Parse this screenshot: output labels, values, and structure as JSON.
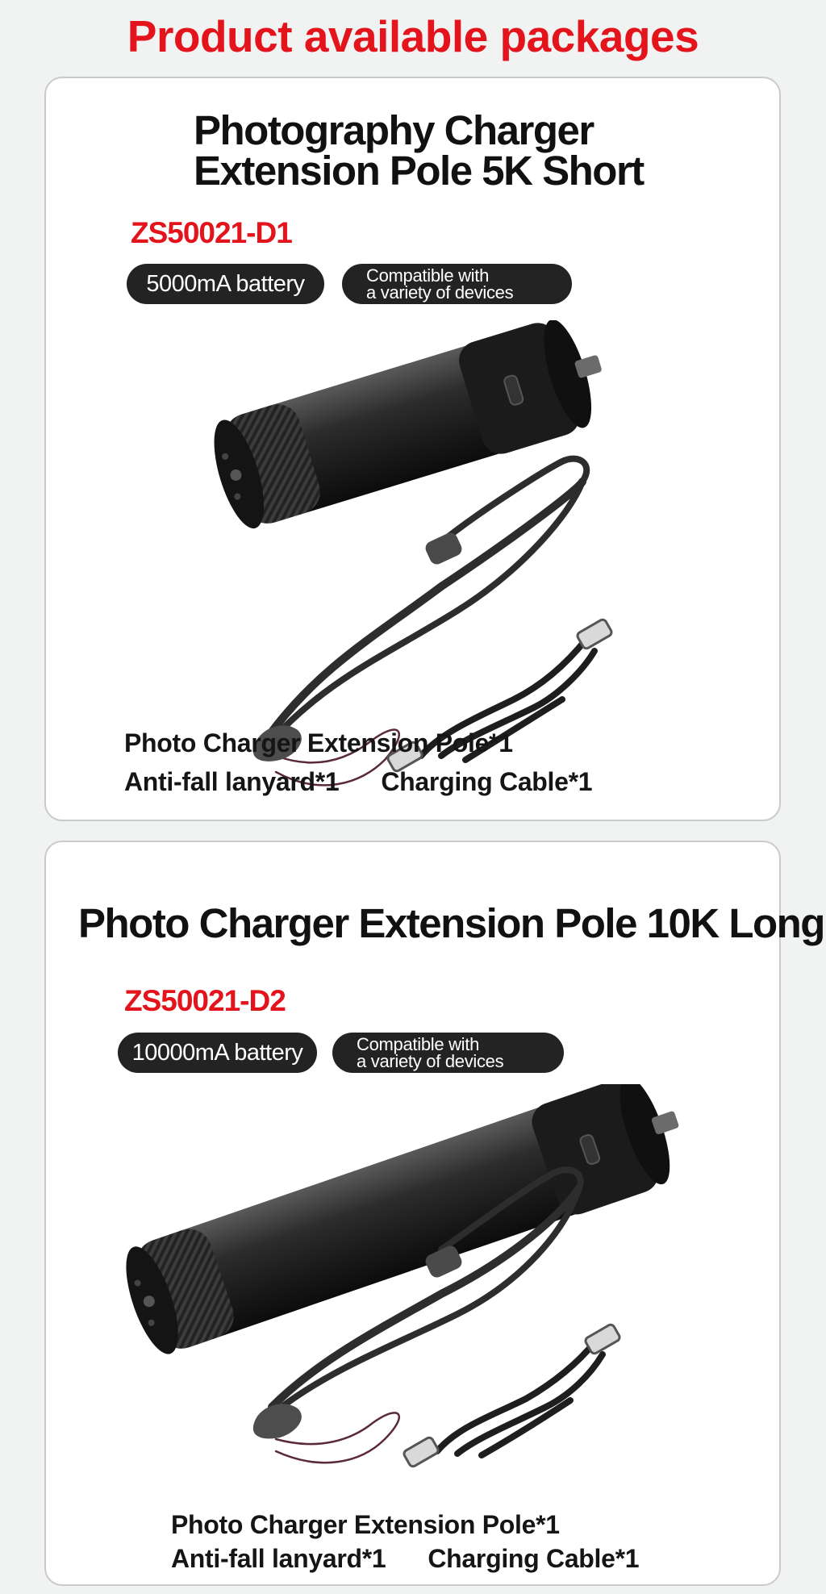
{
  "page": {
    "title": "Product available packages"
  },
  "packages": [
    {
      "title_line1": "Photography Charger",
      "title_line2": "Extension Pole 5K Short",
      "model": "ZS50021-D1",
      "battery": "5000mA battery",
      "compat_line1": "Compatible with",
      "compat_line2": "a  variety of devices",
      "contents": {
        "item1": "Photo Charger Extension Pole*1",
        "item2": "Anti-fall lanyard*1",
        "item3": "Charging Cable*1"
      }
    },
    {
      "title": "Photo Charger Extension Pole 10K Long",
      "model": "ZS50021-D2",
      "battery": "10000mA battery",
      "compat_line1": "Compatible with",
      "compat_line2": "a  variety of devices",
      "contents": {
        "item1": "Photo Charger Extension Pole*1",
        "item2": "Anti-fall lanyard*1",
        "item3": "Charging Cable*1"
      }
    }
  ],
  "colors": {
    "accent_red": "#e3141b",
    "pill_background": "#232323",
    "page_background": "#f1f2f2",
    "card_border": "#c9cacc"
  }
}
